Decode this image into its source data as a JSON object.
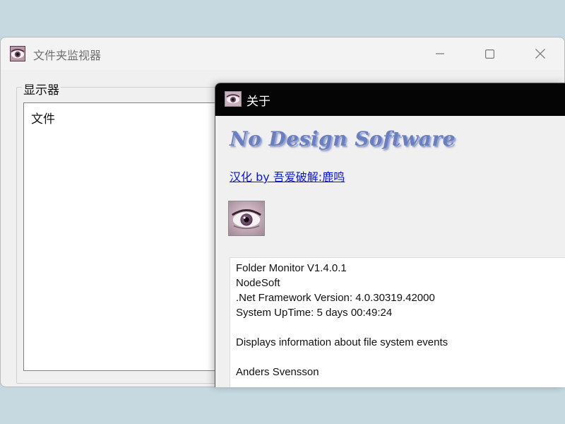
{
  "main_window": {
    "title": "文件夹监视器",
    "controls": {
      "minimize": "—",
      "maximize": "☐",
      "close": "✕"
    },
    "groupbox_label": "显示器",
    "list_header": "文件"
  },
  "about_dialog": {
    "title": "关于",
    "brand": "No Design Software",
    "credit_link": "汉化 by 吾爱破解:鹿鸣",
    "info_lines": [
      "Folder Monitor V1.4.0.1",
      "NodeSoft",
      ".Net Framework Version: 4.0.30319.42000",
      "System UpTime: 5 days 00:49:24",
      "",
      "Displays information about file system events",
      "",
      "Anders Svensson"
    ]
  },
  "icons": {
    "app_icon": "eye-icon"
  },
  "colors": {
    "desktop": "#c6d8e0",
    "about_titlebar": "#050505",
    "link": "#0b17d8",
    "brand": "#6a7fc2"
  }
}
